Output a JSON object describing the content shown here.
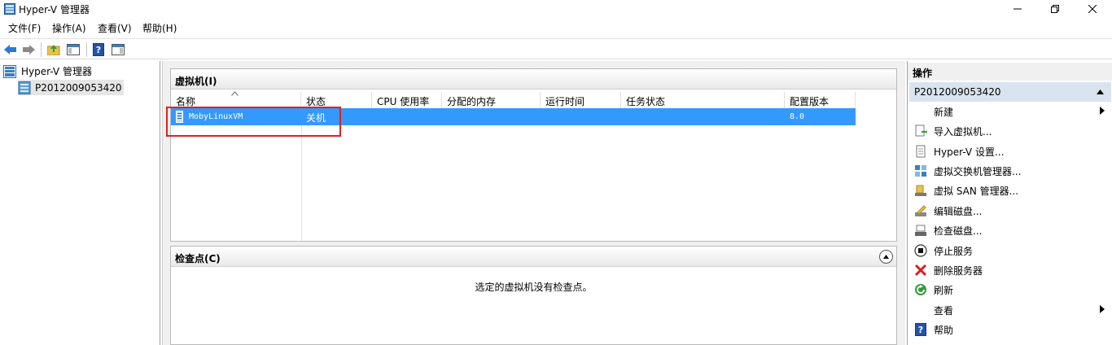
{
  "window": {
    "title": "Hyper-V 管理器"
  },
  "menu": [
    "文件(F)",
    "操作(A)",
    "查看(V)",
    "帮助(H)"
  ],
  "tree": {
    "root": "Hyper-V 管理器",
    "server": "P2012009053420"
  },
  "vm_panel": {
    "title": "虚拟机(I)",
    "columns": [
      "名称",
      "状态",
      "CPU 使用率",
      "分配的内存",
      "运行时间",
      "任务状态",
      "配置版本"
    ],
    "rows": [
      {
        "name": "MobyLinuxVM",
        "state": "关机",
        "cpu": "",
        "memory": "",
        "uptime": "",
        "task": "",
        "version": "8.0"
      }
    ]
  },
  "checkpoint_panel": {
    "title": "检查点(C)",
    "empty_message": "选定的虚拟机没有检查点。"
  },
  "actions": {
    "header": "操作",
    "section": "P2012009053420",
    "items": [
      {
        "label": "新建",
        "icon": "none",
        "submenu": true
      },
      {
        "label": "导入虚拟机...",
        "icon": "import-vm-icon"
      },
      {
        "label": "Hyper-V 设置...",
        "icon": "settings-doc-icon"
      },
      {
        "label": "虚拟交换机管理器...",
        "icon": "switch-manager-icon"
      },
      {
        "label": "虚拟 SAN 管理器...",
        "icon": "san-manager-icon"
      },
      {
        "label": "编辑磁盘...",
        "icon": "edit-disk-icon"
      },
      {
        "label": "检查磁盘...",
        "icon": "inspect-disk-icon"
      },
      {
        "label": "停止服务",
        "icon": "stop-service-icon"
      },
      {
        "label": "删除服务器",
        "icon": "remove-server-icon"
      },
      {
        "label": "刷新",
        "icon": "refresh-icon"
      },
      {
        "label": "查看",
        "icon": "none",
        "submenu": true
      },
      {
        "label": "帮助",
        "icon": "help-icon"
      }
    ]
  },
  "colors": {
    "selection": "#3399ff",
    "highlight_box": "#e02020",
    "section_bg": "#d9e4f0"
  }
}
